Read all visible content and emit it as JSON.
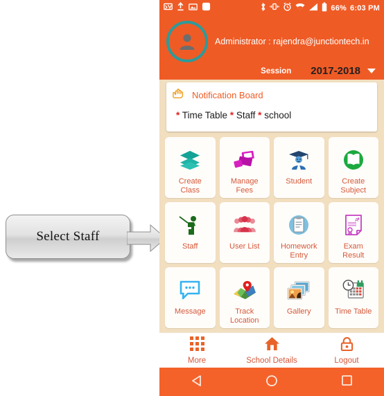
{
  "callout": {
    "label": "Select Staff",
    "arrow_icon": "right-arrow-icon"
  },
  "statusbar": {
    "left_icons": [
      "mail-icon",
      "upload-icon",
      "image-icon",
      "app-icon"
    ],
    "right_icons": [
      "bluetooth-icon",
      "vibrate-icon",
      "alarm-icon",
      "wifi-icon",
      "signal-icon",
      "battery-icon"
    ],
    "battery_percent": "66%",
    "time": "6:03 PM"
  },
  "header": {
    "avatar_icon": "user-avatar-icon",
    "admin_text": "Administrator : rajendra@junctiontech.in",
    "session_label": "Session",
    "session_value": "2017-2018",
    "dropdown_icon": "chevron-down-icon"
  },
  "notification": {
    "icon": "pointing-hand-icon",
    "title": "Notification Board",
    "items": [
      "Time Table",
      "Staff",
      "school"
    ],
    "body_text": "* Time Table * Staff * school"
  },
  "grid": {
    "tiles": [
      {
        "label": "Create\nClass",
        "line1": "Create",
        "line2": "Class",
        "icon": "layers-icon",
        "color": "#1aa79a"
      },
      {
        "label": "Manage Fees",
        "line1": "Manage",
        "line2": "Fees",
        "icon": "money-icon",
        "color": "#cc27b0"
      },
      {
        "label": "Student",
        "line1": "Student",
        "line2": "",
        "icon": "graduate-icon",
        "color": "#2f6fb5"
      },
      {
        "label": "Create Subject",
        "line1": "Create",
        "line2": "Subject",
        "icon": "book-icon",
        "color": "#23a94a"
      },
      {
        "label": "Staff",
        "line1": "Staff",
        "line2": "",
        "icon": "teacher-icon",
        "color": "#1c6b1c"
      },
      {
        "label": "User List",
        "line1": "User List",
        "line2": "",
        "icon": "people-icon",
        "color": "#e2576a"
      },
      {
        "label": "Homework Entry",
        "line1": "Homework",
        "line2": "Entry",
        "icon": "clipboard-icon",
        "color": "#6fb4d8"
      },
      {
        "label": "Exam Result",
        "line1": "Exam",
        "line2": "Result",
        "icon": "certificate-icon",
        "color": "#c43fc0"
      },
      {
        "label": "Message",
        "line1": "Message",
        "line2": "",
        "icon": "chat-bubble-icon",
        "color": "#35b3ef"
      },
      {
        "label": "Track Location",
        "line1": "Track",
        "line2": "Location",
        "icon": "map-pin-icon",
        "color": "#d93025"
      },
      {
        "label": "Gallery",
        "line1": "Gallery",
        "line2": "",
        "icon": "photos-icon",
        "color": "#e8a33d"
      },
      {
        "label": "Time Table",
        "line1": "Time Table",
        "line2": "",
        "icon": "calendar-clock-icon",
        "color": "#2f9e5f"
      }
    ]
  },
  "bottomnav": {
    "items": [
      {
        "label": "More",
        "icon": "grid-icon"
      },
      {
        "label": "School Details",
        "icon": "home-icon"
      },
      {
        "label": "Logout",
        "icon": "lock-icon"
      }
    ]
  },
  "androidbar": {
    "back_icon": "back-triangle-icon",
    "home_icon": "home-circle-icon",
    "recents_icon": "recents-square-icon"
  },
  "colors": {
    "orange": "#ef5b25",
    "beige": "#f2dfc0",
    "tile_label": "#d4583a",
    "teal_ring": "#2e9a9a"
  }
}
